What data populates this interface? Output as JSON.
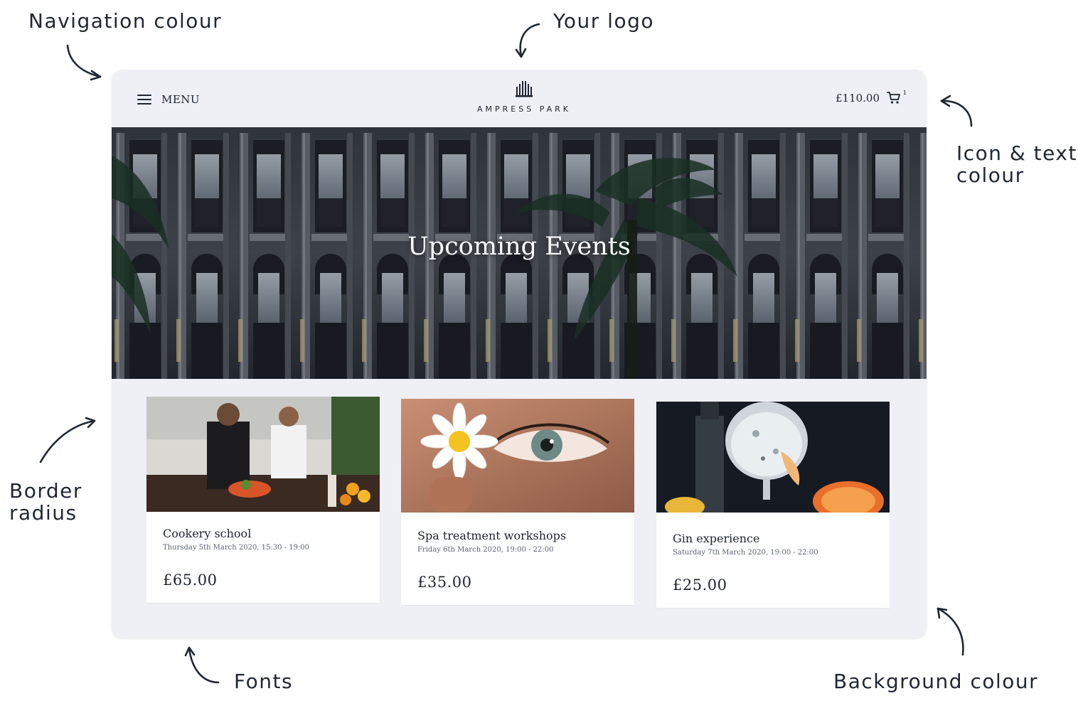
{
  "annotations": {
    "navigation_colour": "Navigation colour",
    "your_logo": "Your logo",
    "icon_text_colour_1": "Icon & text",
    "icon_text_colour_2": "colour",
    "border_radius_1": "Border",
    "border_radius_2": "radius",
    "fonts": "Fonts",
    "background_colour": "Background colour"
  },
  "nav": {
    "menu_label": "MENU",
    "logo_text": "AMPRESS PARK",
    "cart_total": "£110.00",
    "cart_count": "1"
  },
  "hero": {
    "title": "Upcoming Events"
  },
  "events": [
    {
      "title": "Cookery school",
      "date": "Thursday 5th March 2020, 15:30 - 19:00",
      "price": "£65.00"
    },
    {
      "title": "Spa treatment workshops",
      "date": "Friday 6th March 2020, 19:00 - 22:00",
      "price": "£35.00"
    },
    {
      "title": "Gin experience",
      "date": "Saturday 7th March 2020, 19:00 - 22:00",
      "price": "£25.00"
    }
  ],
  "icons": [
    "hamburger-menu-icon",
    "logo-building-icon",
    "cart-icon"
  ],
  "colors": {
    "navigation": "#eef0f5",
    "background": "#eef0f5",
    "text": "#1d2430",
    "card": "#ffffff"
  }
}
